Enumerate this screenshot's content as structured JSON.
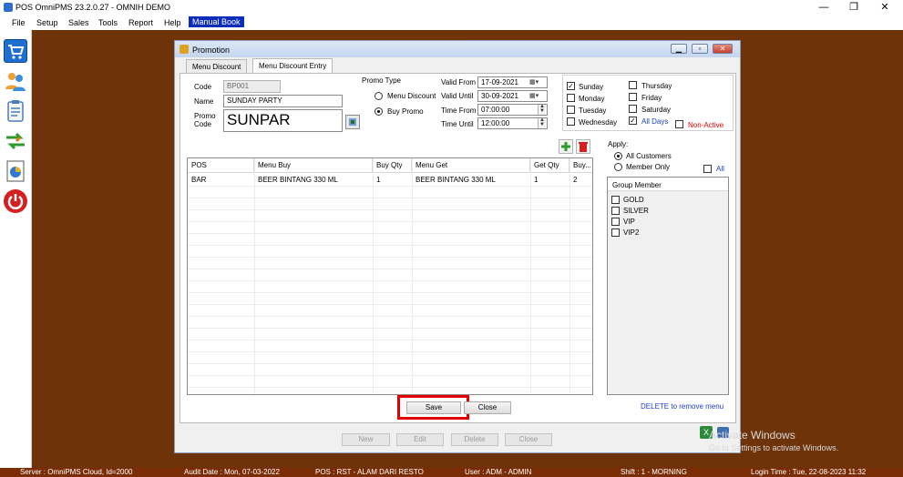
{
  "window": {
    "title": "POS OmniPMS 23.2.0.27 - OMNIH DEMO",
    "minimize": "—",
    "restore": "❐",
    "close": "✕"
  },
  "menu": {
    "items": [
      "File",
      "Setup",
      "Sales",
      "Tools",
      "Report",
      "Help"
    ],
    "manual_book": "Manual Book"
  },
  "sidebar": {
    "icons": [
      "cart-icon",
      "users-icon",
      "clipboard-icon",
      "transfer-arrows-icon",
      "report-chart-icon",
      "power-icon"
    ]
  },
  "dialog": {
    "title": "Promotion",
    "tabs": [
      "Menu Discount",
      "Menu Discount Entry"
    ],
    "code_label": "Code",
    "code_value": "BP001",
    "name_label": "Name",
    "name_value": "SUNDAY PARTY",
    "promo_code_label_1": "Promo",
    "promo_code_label_2": "Code",
    "promo_code_value": "SUNPAR",
    "promo_type_label": "Promo Type",
    "promo_type_options": [
      "Menu Discount",
      "Buy Promo"
    ],
    "promo_type_selected": "Buy Promo",
    "valid_from_label": "Valid From",
    "valid_from_value": "17-09-2021",
    "valid_until_label": "Valid Until",
    "valid_until_value": "30-09-2021",
    "time_from_label": "Time From",
    "time_from_value": "07:00:00",
    "time_until_label": "Time Until",
    "time_until_value": "12:00:00",
    "days": {
      "sunday": {
        "label": "Sunday",
        "checked": true
      },
      "monday": {
        "label": "Monday",
        "checked": false
      },
      "tuesday": {
        "label": "Tuesday",
        "checked": false
      },
      "wednesday": {
        "label": "Wednesday",
        "checked": false
      },
      "thursday": {
        "label": "Thursday",
        "checked": false
      },
      "friday": {
        "label": "Friday",
        "checked": false
      },
      "saturday": {
        "label": "Saturday",
        "checked": false
      },
      "all_days": {
        "label": "All Days",
        "checked": true
      }
    },
    "non_active_label": "Non-Active",
    "apply_label": "Apply:",
    "apply_options": [
      "All Customers",
      "Member Only"
    ],
    "apply_selected": "All Customers",
    "all_label": "All",
    "group_member_label": "Group Member",
    "groups": [
      "GOLD",
      "SILVER",
      "VIP",
      "VIP2"
    ],
    "delete_hint": "DELETE to remove menu",
    "grid": {
      "columns": [
        "POS",
        "Menu Buy",
        "Buy Qty",
        "Menu Get",
        "Get Qty",
        "Buy..."
      ],
      "rows": [
        [
          "BAR",
          "BEER BINTANG 330 ML",
          "1",
          "BEER BINTANG 330 ML",
          "1",
          "2"
        ]
      ]
    },
    "save_label": "Save",
    "close_label": "Close",
    "footer_buttons": [
      "New",
      "Edit",
      "Delete",
      "Close"
    ]
  },
  "watermark": {
    "line1": "Activate Windows",
    "line2": "Go to Settings to activate Windows."
  },
  "status": {
    "server": "Server : OmniPMS Cloud, Id=2000",
    "audit": "Audit Date : Mon, 07-03-2022",
    "pos": "POS : RST - ALAM DARI RESTO",
    "user": "User : ADM - ADMIN",
    "shift": "Shift : 1 - MORNING",
    "login": "Login Time : Tue, 22-08-2023 11:32"
  },
  "colors": {
    "workspace": "#6e3309",
    "status_bar": "#7a2c05",
    "highlight_box": "#e00000",
    "link_blue": "#1e3cc8"
  }
}
